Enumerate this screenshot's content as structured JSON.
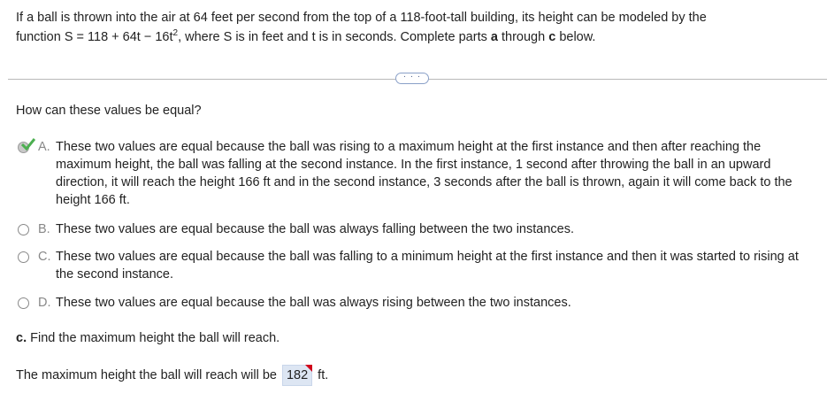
{
  "problem": {
    "line1": "If a ball is thrown into the air at 64 feet per second from the top of a 118-foot-tall building, its height can be modeled by the",
    "line2_start": "function S = 118 + 64t − 16t",
    "line2_exp": "2",
    "line2_mid": ", where S is in feet and t is in seconds. Complete parts ",
    "part_a": "a",
    "line2_through": " through ",
    "part_c": "c",
    "line2_end": " below."
  },
  "more_button": {
    "label": "· · ·"
  },
  "question": "How can these values be equal?",
  "options": [
    {
      "letter": "A.",
      "text": "These two values are equal because the ball was rising to a maximum height at the first instance and then after reaching the maximum height, the ball was falling at the second instance. In the first instance, 1 second after throwing the ball in an upward direction, it will reach the height 166 ft and in the second instance, 3 seconds after the ball is thrown, again it will come back to the height 166 ft.",
      "selected": true
    },
    {
      "letter": "B.",
      "text": "These two values are equal because the ball was always falling between the two instances.",
      "selected": false
    },
    {
      "letter": "C.",
      "text": "These two values are equal because the ball was falling to a minimum height at the first instance and then it was started to rising at the second instance.",
      "selected": false
    },
    {
      "letter": "D.",
      "text": "These two values are equal because the ball was always rising between the two instances.",
      "selected": false
    }
  ],
  "part_c": {
    "label": "c.",
    "text": " Find the maximum height the ball will reach."
  },
  "answer": {
    "prefix": "The maximum height the ball will reach will be",
    "value": "182",
    "unit": "ft."
  },
  "colors": {
    "check": "#4caf50",
    "answer_bg": "#dde6f3",
    "flag": "#d0021b"
  }
}
